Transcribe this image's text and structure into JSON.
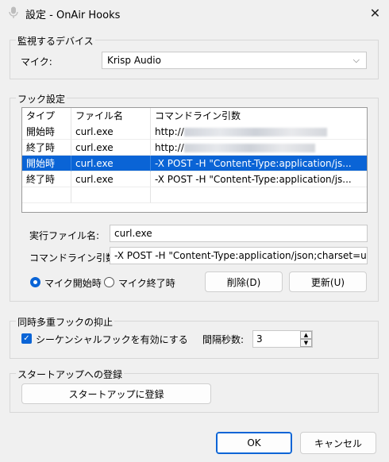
{
  "window": {
    "title": "設定 - OnAir Hooks",
    "close": "✕",
    "icon": "microphone-icon"
  },
  "device": {
    "group_label": "監視するデバイス",
    "mic_label": "マイク:",
    "mic_value": "Krisp Audio"
  },
  "hooks": {
    "group_label": "フック設定",
    "columns": [
      "タイプ",
      "ファイル名",
      "コマンドライン引数"
    ],
    "rows": [
      {
        "type": "開始時",
        "file": "curl.exe",
        "args": "http://"
      },
      {
        "type": "終了時",
        "file": "curl.exe",
        "args": "http://"
      },
      {
        "type": "開始時",
        "file": "curl.exe",
        "args": "-X POST -H \"Content-Type:application/js..."
      },
      {
        "type": "終了時",
        "file": "curl.exe",
        "args": "-X POST -H \"Content-Type:application/js..."
      }
    ],
    "exe_label": "実行ファイル名:",
    "exe_value": "curl.exe",
    "args_label": "コマンドライン引数:",
    "args_value": "-X POST -H \"Content-Type:application/json;charset=u",
    "radio_start": "マイク開始時",
    "radio_end": "マイク終了時",
    "delete_button": "削除(D)",
    "update_button": "更新(U)"
  },
  "suppress": {
    "group_label": "同時多重フックの抑止",
    "sequential_label": "シーケンシャルフックを有効にする",
    "interval_label": "間隔秒数:",
    "interval_value": "3"
  },
  "startup": {
    "group_label": "スタートアップへの登録",
    "register_button": "スタートアップに登録"
  },
  "footer": {
    "ok": "OK",
    "cancel": "キャンセル"
  },
  "colors": {
    "accent": "#0a64d6",
    "background": "#f0f0f0"
  }
}
